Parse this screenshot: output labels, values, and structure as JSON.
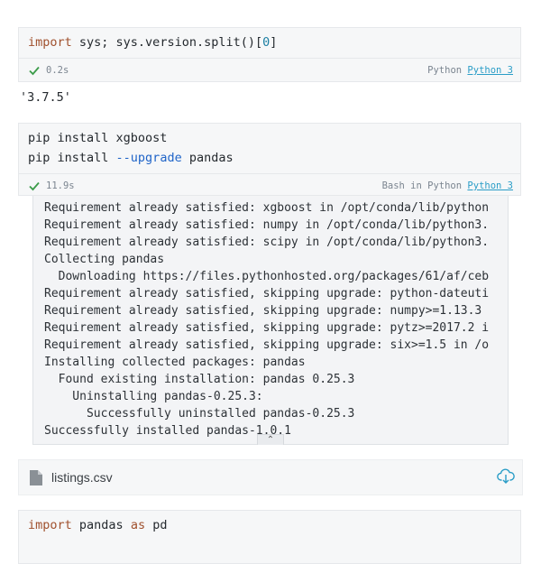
{
  "cells": [
    {
      "code_line1": {
        "import": "import",
        "rest": " sys; sys.version.split()[",
        "index": "0",
        "close": "]"
      },
      "time": "0.2s",
      "kernel_lang": "Python",
      "kernel_name": "Python 3",
      "output": "'3.7.5'"
    },
    {
      "line1": "pip install xgboost",
      "line2_a": "pip install ",
      "line2_flag": "--upgrade",
      "line2_b": " pandas",
      "time": "11.9s",
      "kernel_lang": "Bash in Python",
      "kernel_name": "Python 3",
      "stream_lines": [
        "Requirement already satisfied: xgboost in /opt/conda/lib/python",
        "Requirement already satisfied: numpy in /opt/conda/lib/python3.",
        "Requirement already satisfied: scipy in /opt/conda/lib/python3.",
        "Collecting pandas",
        "  Downloading https://files.pythonhosted.org/packages/61/af/ceb",
        "Requirement already satisfied, skipping upgrade: python-dateuti",
        "Requirement already satisfied, skipping upgrade: numpy>=1.13.3",
        "Requirement already satisfied, skipping upgrade: pytz>=2017.2 i",
        "Requirement already satisfied, skipping upgrade: six>=1.5 in /o",
        "Installing collected packages: pandas",
        "  Found existing installation: pandas 0.25.3",
        "    Uninstalling pandas-0.25.3:",
        "      Successfully uninstalled pandas-0.25.3",
        "Successfully installed pandas-1.0.1"
      ],
      "collapse_glyph": "⌃"
    },
    {
      "line1_import": "import",
      "line1_mid": " pandas ",
      "line1_as": "as",
      "line1_end": " pd"
    }
  ],
  "file": {
    "name": "listings.csv",
    "icon": "file-icon",
    "action_icon": "cloud-download-icon"
  },
  "colors": {
    "accent": "#2a9dc7",
    "check": "#3c9c4a"
  }
}
